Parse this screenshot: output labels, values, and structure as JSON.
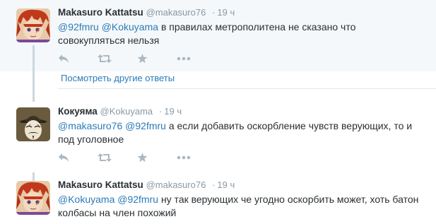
{
  "tweets": [
    {
      "fullname": "Makasuro Kattatsu",
      "username": "@makasuro76",
      "dot": "·",
      "time": "19 ч",
      "mention1": "@92fmru",
      "mention2": "@Kokuyama",
      "text": "в правилах метрополитена не сказано что совокупляться нельзя"
    },
    {
      "fullname": "Кокуяма",
      "username": "@Kokuyama",
      "dot": "·",
      "time": "19 ч",
      "mention1": "@makasuro76",
      "mention2": "@92fmru",
      "text": "а если добавить оскорбление чувств верующих, то и под уголовное"
    },
    {
      "fullname": "Makasuro Kattatsu",
      "username": "@makasuro76",
      "dot": "·",
      "time": "19 ч",
      "mention1": "@Kokuyama",
      "mention2": "@92fmru",
      "text": "ну так верующих че угодно оскорбить может, хоть батон колбасы на член похожий"
    }
  ],
  "more_replies": "Посмотреть другие ответы",
  "icons": {
    "reply": "reply-icon",
    "retweet": "retweet-icon",
    "favorite": "star-icon",
    "more": "more-icon"
  },
  "colors": {
    "link": "#2b7bb9",
    "muted": "#8899a6",
    "icon": "#aab8c2",
    "highlight_bg": "#f5f8fa",
    "thread_line": "#ccd6dd"
  }
}
